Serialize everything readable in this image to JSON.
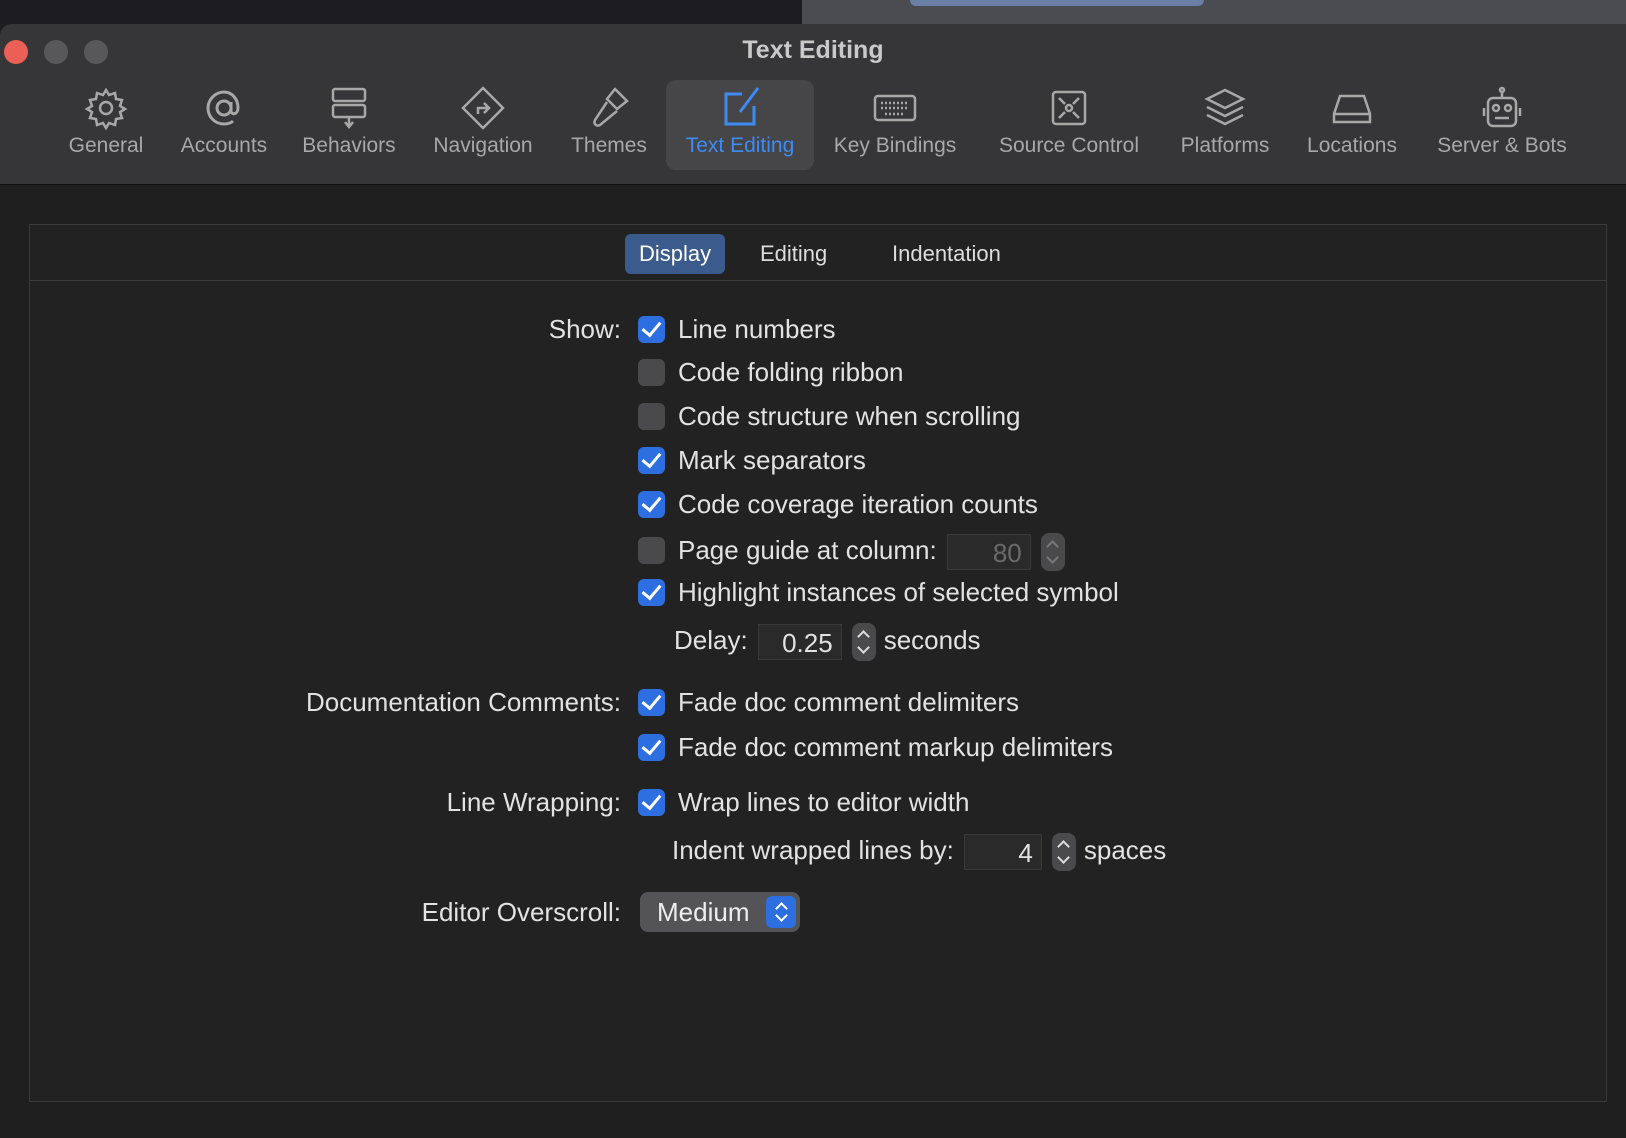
{
  "window": {
    "title": "Text Editing"
  },
  "toolbar": {
    "items": [
      {
        "label": "General",
        "icon": "gear-icon"
      },
      {
        "label": "Accounts",
        "icon": "at-icon"
      },
      {
        "label": "Behaviors",
        "icon": "behaviors-icon"
      },
      {
        "label": "Navigation",
        "icon": "navigation-icon"
      },
      {
        "label": "Themes",
        "icon": "brush-icon"
      },
      {
        "label": "Text Editing",
        "icon": "pencil-square-icon",
        "selected": true
      },
      {
        "label": "Key Bindings",
        "icon": "keyboard-icon"
      },
      {
        "label": "Source Control",
        "icon": "source-control-icon"
      },
      {
        "label": "Platforms",
        "icon": "layers-icon"
      },
      {
        "label": "Locations",
        "icon": "drive-icon"
      },
      {
        "label": "Server & Bots",
        "icon": "robot-icon"
      }
    ]
  },
  "tabs": [
    {
      "label": "Display",
      "selected": true
    },
    {
      "label": "Editing"
    },
    {
      "label": "Indentation"
    }
  ],
  "show": {
    "label": "Show:",
    "line_numbers": {
      "label": "Line numbers",
      "checked": true
    },
    "code_folding": {
      "label": "Code folding ribbon",
      "checked": false
    },
    "code_structure": {
      "label": "Code structure when scrolling",
      "checked": false
    },
    "mark_separators": {
      "label": "Mark separators",
      "checked": true
    },
    "coverage": {
      "label": "Code coverage iteration counts",
      "checked": true
    },
    "page_guide": {
      "label": "Page guide at column:",
      "checked": false,
      "value": "80"
    },
    "highlight": {
      "label": "Highlight instances of selected symbol",
      "checked": true
    },
    "delay": {
      "label": "Delay:",
      "value": "0.25",
      "unit": "seconds"
    }
  },
  "doc_comments": {
    "label": "Documentation Comments:",
    "fade_delims": {
      "label": "Fade doc comment delimiters",
      "checked": true
    },
    "fade_markup": {
      "label": "Fade doc comment markup delimiters",
      "checked": true
    }
  },
  "line_wrapping": {
    "label": "Line Wrapping:",
    "wrap": {
      "label": "Wrap lines to editor width",
      "checked": true
    },
    "indent": {
      "label": "Indent wrapped lines by:",
      "value": "4",
      "unit": "spaces"
    }
  },
  "overscroll": {
    "label": "Editor Overscroll:",
    "value": "Medium"
  },
  "colors": {
    "accent": "#2d6fe0",
    "selected_tab": "#3b5b8c",
    "close": "#ec5f56"
  }
}
